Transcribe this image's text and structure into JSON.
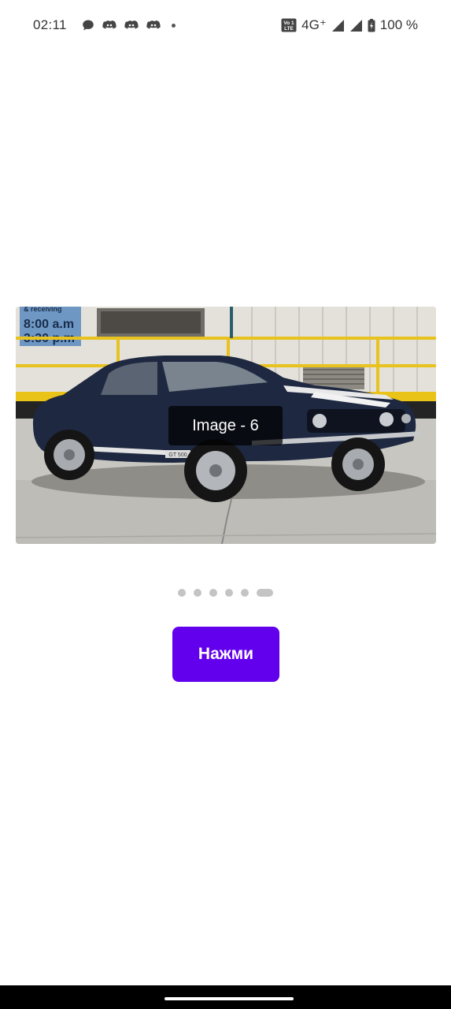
{
  "status_bar": {
    "time": "02:11",
    "network": "4G⁺",
    "battery": "100 %",
    "volte_label": "Vo LTE",
    "icons": [
      "chat-bubble-icon",
      "discord-icon",
      "discord-icon",
      "discord-icon",
      "more-dot-icon",
      "volte-icon",
      "signal-icon",
      "signal-icon",
      "battery-icon"
    ]
  },
  "carousel": {
    "caption": "Image - 6",
    "sign_line1": "& receiving",
    "sign_line2": "8:00 a.m",
    "sign_line3": "3:30 p.m",
    "plate_text": "GT 500",
    "active_index": 6,
    "total": 6
  },
  "button": {
    "label": "Нажми",
    "color": "#6200ee"
  }
}
